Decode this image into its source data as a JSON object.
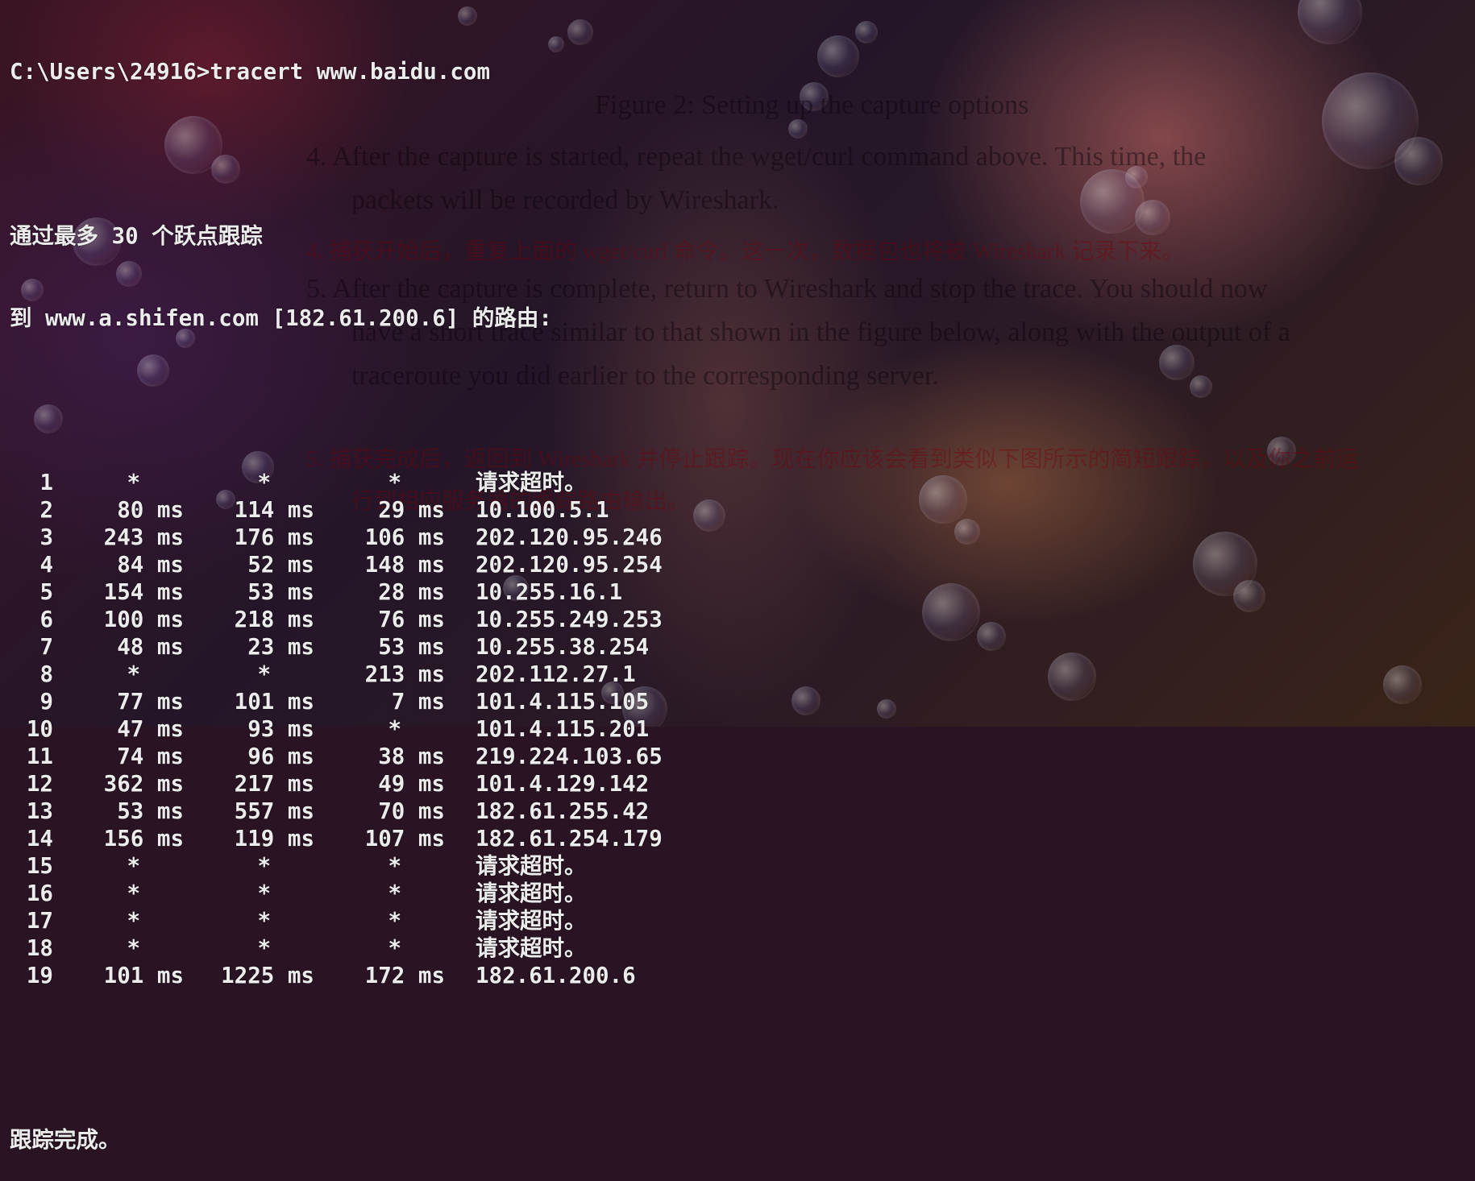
{
  "terminal": {
    "command_line": "C:\\Users\\24916>tracert www.baidu.com",
    "header_line1": "通过最多 30 个跃点跟踪",
    "header_line2": "到 www.a.shifen.com [182.61.200.6] 的路由:",
    "hops": [
      {
        "hop": "1",
        "rtt1": "*",
        "rtt2": "*",
        "rtt3": "*",
        "dest": "请求超时。"
      },
      {
        "hop": "2",
        "rtt1": "80 ms",
        "rtt2": "114 ms",
        "rtt3": "29 ms",
        "dest": "10.100.5.1"
      },
      {
        "hop": "3",
        "rtt1": "243 ms",
        "rtt2": "176 ms",
        "rtt3": "106 ms",
        "dest": "202.120.95.246"
      },
      {
        "hop": "4",
        "rtt1": "84 ms",
        "rtt2": "52 ms",
        "rtt3": "148 ms",
        "dest": "202.120.95.254"
      },
      {
        "hop": "5",
        "rtt1": "154 ms",
        "rtt2": "53 ms",
        "rtt3": "28 ms",
        "dest": "10.255.16.1"
      },
      {
        "hop": "6",
        "rtt1": "100 ms",
        "rtt2": "218 ms",
        "rtt3": "76 ms",
        "dest": "10.255.249.253"
      },
      {
        "hop": "7",
        "rtt1": "48 ms",
        "rtt2": "23 ms",
        "rtt3": "53 ms",
        "dest": "10.255.38.254"
      },
      {
        "hop": "8",
        "rtt1": "*",
        "rtt2": "*",
        "rtt3": "213 ms",
        "dest": "202.112.27.1"
      },
      {
        "hop": "9",
        "rtt1": "77 ms",
        "rtt2": "101 ms",
        "rtt3": "7 ms",
        "dest": "101.4.115.105"
      },
      {
        "hop": "10",
        "rtt1": "47 ms",
        "rtt2": "93 ms",
        "rtt3": "*",
        "dest": "101.4.115.201"
      },
      {
        "hop": "11",
        "rtt1": "74 ms",
        "rtt2": "96 ms",
        "rtt3": "38 ms",
        "dest": "219.224.103.65"
      },
      {
        "hop": "12",
        "rtt1": "362 ms",
        "rtt2": "217 ms",
        "rtt3": "49 ms",
        "dest": "101.4.129.142"
      },
      {
        "hop": "13",
        "rtt1": "53 ms",
        "rtt2": "557 ms",
        "rtt3": "70 ms",
        "dest": "182.61.255.42"
      },
      {
        "hop": "14",
        "rtt1": "156 ms",
        "rtt2": "119 ms",
        "rtt3": "107 ms",
        "dest": "182.61.254.179"
      },
      {
        "hop": "15",
        "rtt1": "*",
        "rtt2": "*",
        "rtt3": "*",
        "dest": "请求超时。"
      },
      {
        "hop": "16",
        "rtt1": "*",
        "rtt2": "*",
        "rtt3": "*",
        "dest": "请求超时。"
      },
      {
        "hop": "17",
        "rtt1": "*",
        "rtt2": "*",
        "rtt3": "*",
        "dest": "请求超时。"
      },
      {
        "hop": "18",
        "rtt1": "*",
        "rtt2": "*",
        "rtt3": "*",
        "dest": "请求超时。"
      },
      {
        "hop": "19",
        "rtt1": "101 ms",
        "rtt2": "1225 ms",
        "rtt3": "172 ms",
        "dest": "182.61.200.6"
      }
    ],
    "footer": "跟踪完成。"
  },
  "background_overlay": {
    "caption": "Figure 2: Setting up the capture options",
    "step4_en_a": "4.   After the capture is started, repeat the wget/curl command above. This time, the",
    "step4_en_b": "packets will be recorded by Wireshark.",
    "step4_cn": "4.   捕获开始后，重复上面的 wget/curl 命令。这一次，数据包也将被 Wireshark 记录下来。",
    "step5_en_a": "5.   After the capture is complete, return to Wireshark and stop the trace. You should now",
    "step5_en_b": "have a short trace similar to that shown in the figure below, along with the output of a",
    "step5_en_c": "traceroute you did earlier to the corresponding server.",
    "step5_cn_a": "5.   捕获完成后，返回到 Wireshark 并停止跟踪。现在你应该会看到类似下图所示的简短跟踪，以及你之前运",
    "step5_cn_b": "行到相应服务器的跟踪路由输出。"
  },
  "colors": {
    "terminal_text": "#ececec",
    "background": "#2a1424"
  }
}
